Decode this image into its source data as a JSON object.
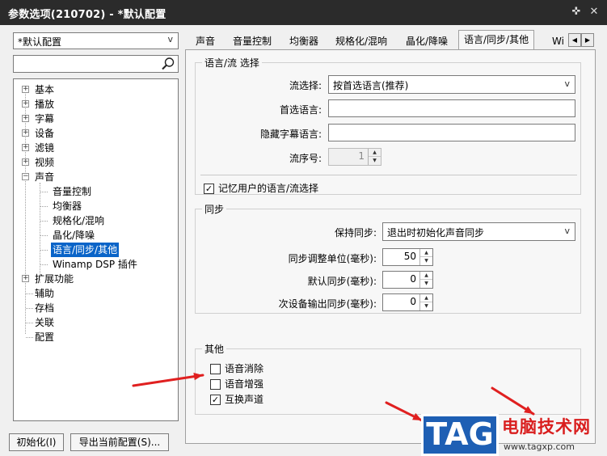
{
  "window": {
    "title": "参数选项(210702) - *默认配置",
    "pin_glyph": "✜",
    "close_glyph": "✕"
  },
  "left": {
    "profile_value": "*默认配置",
    "search_value": "",
    "tree": [
      {
        "label": "基本",
        "expander": "+"
      },
      {
        "label": "播放",
        "expander": "+"
      },
      {
        "label": "字幕",
        "expander": "+"
      },
      {
        "label": "设备",
        "expander": "+"
      },
      {
        "label": "滤镜",
        "expander": "+"
      },
      {
        "label": "视频",
        "expander": "+"
      },
      {
        "label": "声音",
        "expander": "−"
      },
      {
        "label": "音量控制"
      },
      {
        "label": "均衡器"
      },
      {
        "label": "规格化/混响"
      },
      {
        "label": "晶化/降噪"
      },
      {
        "label": "语言/同步/其他",
        "selected": true
      },
      {
        "label": "Winamp DSP 插件"
      },
      {
        "label": "扩展功能",
        "expander": "+"
      },
      {
        "label": "辅助"
      },
      {
        "label": "存档"
      },
      {
        "label": "关联"
      },
      {
        "label": "配置"
      }
    ]
  },
  "tabs": [
    "声音",
    "音量控制",
    "均衡器",
    "规格化/混响",
    "晶化/降噪",
    "语言/同步/其他",
    "Wi"
  ],
  "tab_scroll": {
    "left": "◀",
    "right": "▶"
  },
  "lang_group": {
    "title": "语言/流 选择",
    "stream_select_label": "流选择:",
    "stream_select_value": "按首选语言(推荐)",
    "preferred_lang_label": "首选语言:",
    "preferred_lang_value": "",
    "hidden_sub_label": "隐藏字幕语言:",
    "hidden_sub_value": "",
    "stream_no_label": "流序号:",
    "stream_no_value": "1",
    "remember_label": "记忆用户的语言/流选择",
    "remember_checked": "✓"
  },
  "sync_group": {
    "title": "同步",
    "keep_sync_label": "保持同步:",
    "keep_sync_value": "退出时初始化声音同步",
    "adjust_unit_label": "同步调整单位(毫秒):",
    "adjust_unit_value": "50",
    "default_sync_label": "默认同步(毫秒):",
    "default_sync_value": "0",
    "secondary_sync_label": "次设备输出同步(毫秒):",
    "secondary_sync_value": "0"
  },
  "other_group": {
    "title": "其他",
    "voice_remove": "语音消除",
    "voice_boost": "语音增强",
    "swap_channels": "互换声道",
    "swap_checked": "✓"
  },
  "buttons": {
    "init": "初始化(I)",
    "export": "导出当前配置(S)..."
  },
  "watermark": {
    "logo": "TAG",
    "site_name": "电脑技术网",
    "url": "www.tagxp.com"
  },
  "arrow_color": "#e02020"
}
